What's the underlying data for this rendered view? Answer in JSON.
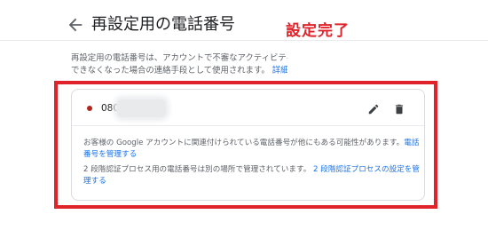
{
  "header": {
    "title": "再設定用の電話番号"
  },
  "annotation": {
    "text": "設定完了",
    "color": "#e0232a"
  },
  "description": {
    "line1": "再設定用の電話番号は、アカウントで不審なアクティビティが",
    "line2": "できなくなった場合の連絡手段として使用されます。",
    "link": "詳細"
  },
  "phone": {
    "number_prefix": "080-",
    "status_color": "#b3261e",
    "edit_icon": "pencil-icon",
    "delete_icon": "trash-icon"
  },
  "notes": {
    "note1_text": "お客様の Google アカウントに関連付けられている電話番号が他にもある可能性があります。",
    "note1_link": "電話番号を管理する",
    "note2_text": "2 段階認証プロセス用の電話番号は別の場所で管理されています。",
    "note2_link": "2 段階認証プロセスの設定を管理する"
  },
  "colors": {
    "link": "#1a73e8",
    "highlight": "#e0232a"
  }
}
